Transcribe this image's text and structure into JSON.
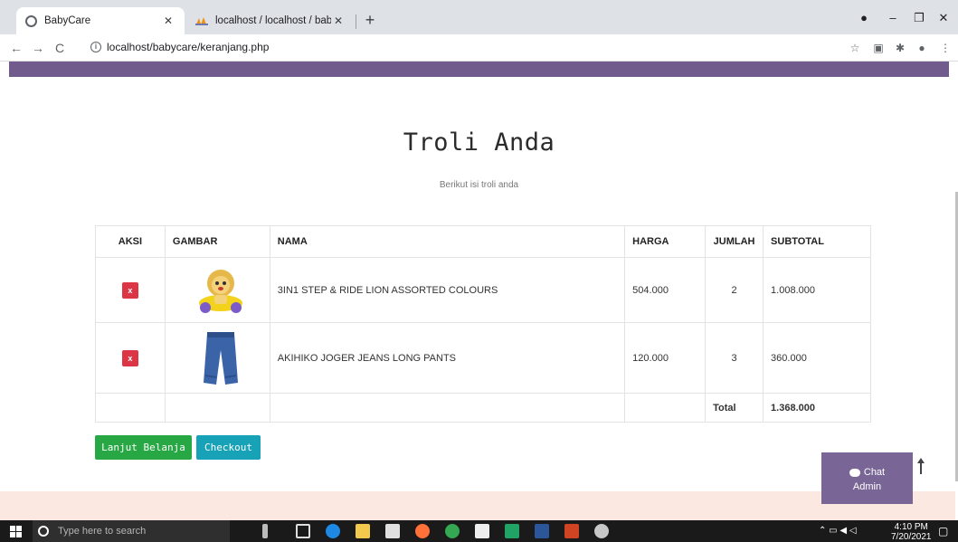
{
  "browser": {
    "tabs": [
      {
        "title": "BabyCare",
        "active": true
      },
      {
        "title": "localhost / localhost / babycare / ",
        "active": false
      }
    ],
    "url": "localhost/babycare/keranjang.php"
  },
  "page": {
    "title": "Troli Anda",
    "subtitle": "Berikut isi troli anda"
  },
  "cart": {
    "headers": [
      "AKSI",
      "GAMBAR",
      "NAMA",
      "HARGA",
      "JUMLAH",
      "SUBTOTAL"
    ],
    "rows": [
      {
        "delete_label": "x",
        "image": "lion-ride-on-toy",
        "name": "3IN1 STEP & RIDE LION ASSORTED COLOURS",
        "price": "504.000",
        "qty": "2",
        "subtotal": "1.008.000"
      },
      {
        "delete_label": "x",
        "image": "jeans-pants",
        "name": "AKIHIKO JOGER JEANS LONG PANTS",
        "price": "120.000",
        "qty": "3",
        "subtotal": "360.000"
      }
    ],
    "total_label": "Total",
    "total_value": "1.368.000"
  },
  "buttons": {
    "continue": "Lanjut Belanja",
    "checkout": "Checkout"
  },
  "chat": {
    "line1": "Chat",
    "line2": "Admin"
  },
  "taskbar": {
    "search_placeholder": "Type here to search",
    "time": "4:10 PM",
    "date": "7/20/2021"
  },
  "colors": {
    "accent_purple": "#715b8d",
    "delete_red": "#dc3545",
    "continue_green": "#28a745",
    "checkout_teal": "#17a2b8",
    "footer_peach": "#fbe9e1"
  }
}
